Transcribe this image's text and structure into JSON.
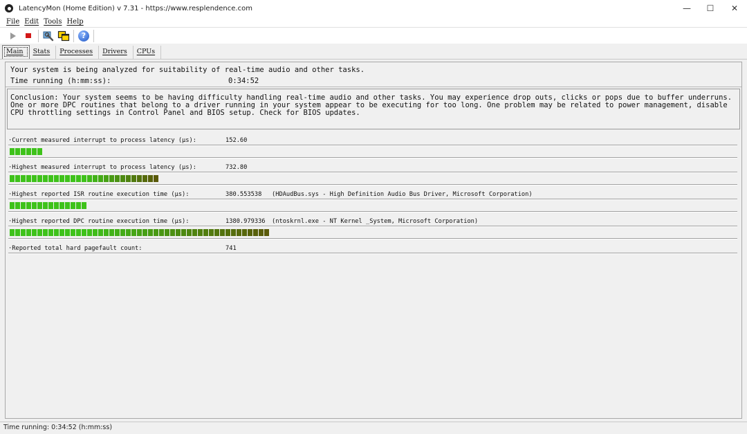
{
  "window": {
    "title": "LatencyMon  (Home Edition)  v 7.31 - https://www.resplendence.com",
    "minimize_glyph": "—",
    "maximize_glyph": "☐",
    "close_glyph": "✕"
  },
  "menu": [
    "File",
    "Edit",
    "Tools",
    "Help"
  ],
  "toolbar": {
    "items": [
      "play-icon",
      "stop-icon",
      "wrench-icon",
      "windows-icon",
      "help-icon"
    ],
    "help_glyph": "?"
  },
  "tabs": [
    "Main",
    "Stats",
    "Processes",
    "Drivers",
    "CPUs"
  ],
  "active_tab": "Main",
  "status_panel": {
    "analyzing_text": "Your system is being analyzed for suitability of real-time audio and other tasks.",
    "time_label": "Time running (h:mm:ss):",
    "time_value": "0:34:52"
  },
  "conclusion": "Conclusion: Your system seems to be having difficulty handling real-time audio and other tasks. You may experience drop outs, clicks or pops due to buffer underruns. One or more DPC routines that belong to a driver running in your system appear to be executing for too long. One problem may be related to power management, disable CPU throttling settings in Control Panel and BIOS setup. Check for BIOS updates.",
  "metrics": [
    {
      "label": "·Current measured interrupt to process latency (µs):",
      "value": "152.60",
      "extra": "",
      "bar_segments": 6
    },
    {
      "label": "·Highest measured interrupt to process latency (µs):",
      "value": "732.80",
      "extra": "",
      "bar_segments": 27
    },
    {
      "label": "·Highest reported ISR routine execution time (µs):",
      "value": "380.553538",
      "extra": "(HDAudBus.sys - High Definition Audio Bus Driver, Microsoft Corporation)",
      "bar_segments": 14
    },
    {
      "label": "·Highest reported DPC routine execution time (µs):",
      "value": "1380.979336",
      "extra": "(ntoskrnl.exe - NT Kernel _System, Microsoft Corporation)",
      "bar_segments": 47
    },
    {
      "label": "·Reported total hard pagefault count:",
      "value": "741",
      "extra": "",
      "bar_segments": 0
    }
  ],
  "colors": {
    "bar_green": "#3ec21a",
    "bar_dark": "#5a5a0a",
    "close_hover": "#e81123"
  },
  "statusbar": {
    "text": "Time running: 0:34:52  (h:mm:ss)"
  }
}
